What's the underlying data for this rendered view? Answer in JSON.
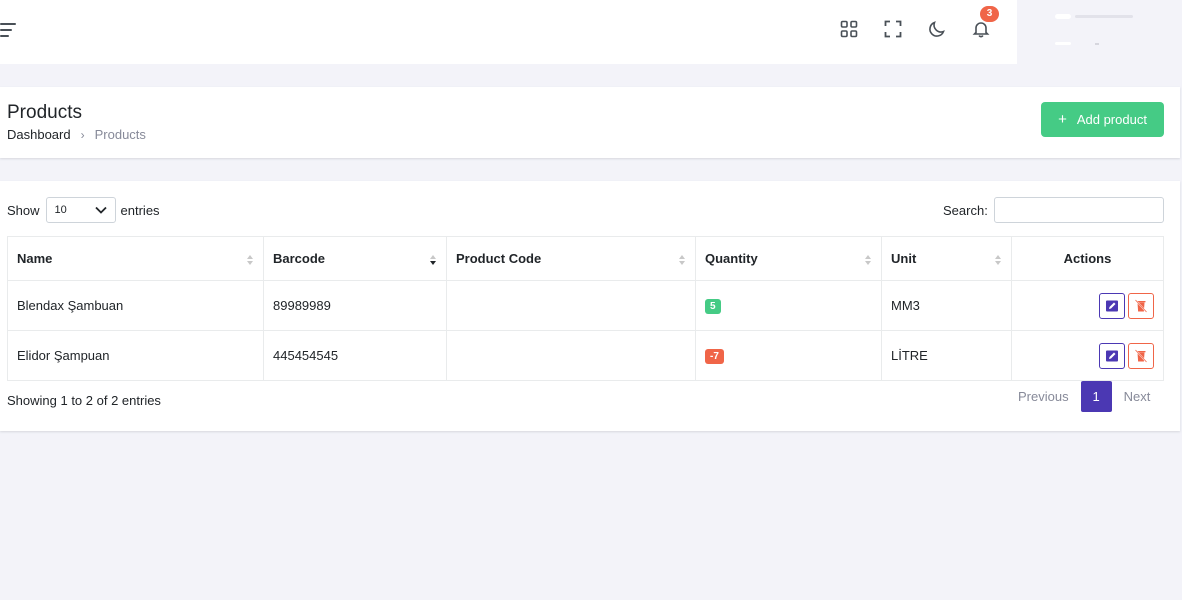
{
  "topbar": {
    "notification_count": "3",
    "icons": [
      "apps-grid-icon",
      "fullscreen-icon",
      "moon-icon",
      "bell-icon"
    ]
  },
  "page": {
    "title": "Products",
    "breadcrumb": [
      "Dashboard",
      "Products"
    ],
    "add_button_label": "Add product"
  },
  "table_controls": {
    "show_label": "Show",
    "length_value": "10",
    "entries_label": "entries",
    "search_label": "Search:",
    "search_value": ""
  },
  "table": {
    "columns": [
      "Name",
      "Barcode",
      "Product Code",
      "Quantity",
      "Unit",
      "Actions"
    ],
    "rows": [
      {
        "name": "Blendax Şambuan",
        "barcode": "89989989",
        "product_code": "",
        "quantity": "5",
        "quantity_status": "positive",
        "unit": "MM3"
      },
      {
        "name": "Elidor Şampuan",
        "barcode": "445454545",
        "product_code": "",
        "quantity": "-7",
        "quantity_status": "negative",
        "unit": "LİTRE"
      }
    ]
  },
  "footer": {
    "info": "Showing 1 to 2 of 2 entries",
    "previous": "Previous",
    "current_page": "1",
    "next": "Next"
  },
  "colors": {
    "primary": "#4b38b3",
    "success": "#45cb85",
    "danger": "#f06548",
    "background": "#f3f3f9"
  }
}
